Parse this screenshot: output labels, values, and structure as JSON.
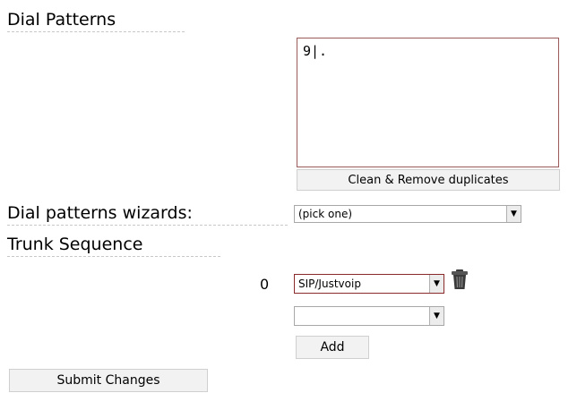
{
  "headings": {
    "dial_patterns": "Dial Patterns",
    "wizards": "Dial patterns wizards:",
    "trunk_sequence": "Trunk Sequence"
  },
  "dial_patterns_textarea": {
    "value": "9|."
  },
  "clean_button": {
    "label": "Clean & Remove duplicates"
  },
  "wizard_select": {
    "selected": "(pick one)"
  },
  "trunk_sequence": {
    "rows": [
      {
        "index": "0",
        "selected": "SIP/Justvoip"
      }
    ],
    "new_row": {
      "selected": ""
    },
    "add_label": "Add",
    "delete_icon": "trash-can-icon"
  },
  "submit_button": {
    "label": "Submit Changes"
  }
}
